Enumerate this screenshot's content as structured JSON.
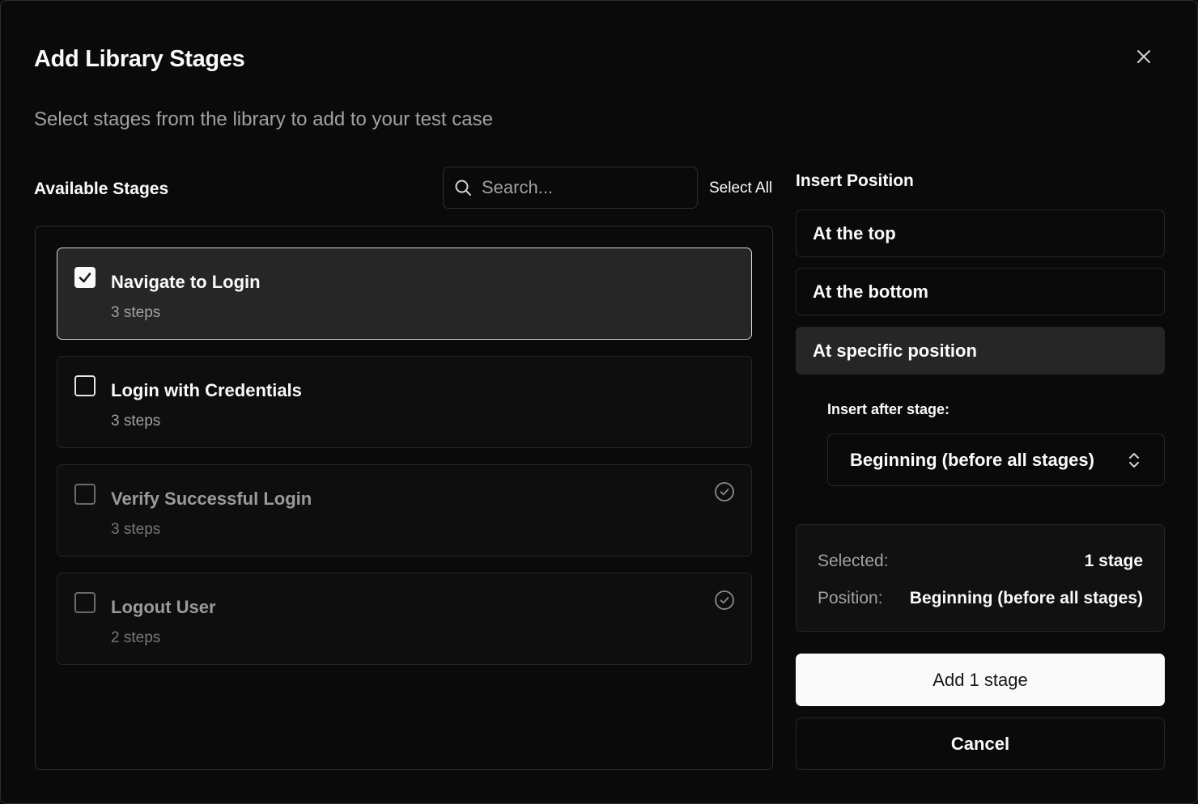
{
  "dialog": {
    "title": "Add Library Stages",
    "subtitle": "Select stages from the library to add to your test case",
    "close_icon": "close-icon"
  },
  "available": {
    "label": "Available Stages",
    "search_placeholder": "Search...",
    "select_all": "Select All",
    "stages": [
      {
        "name": "Navigate to Login",
        "steps": "3 steps",
        "checked": true,
        "already_added": false
      },
      {
        "name": "Login with Credentials",
        "steps": "3 steps",
        "checked": false,
        "already_added": false
      },
      {
        "name": "Verify Successful Login",
        "steps": "3 steps",
        "checked": false,
        "already_added": true
      },
      {
        "name": "Logout User",
        "steps": "2 steps",
        "checked": false,
        "already_added": true
      }
    ]
  },
  "insert_position": {
    "label": "Insert Position",
    "options": [
      "At the top",
      "At the bottom",
      "At specific position"
    ],
    "active_option": "At specific position",
    "after_label": "Insert after stage:",
    "after_value": "Beginning (before all stages)"
  },
  "summary": {
    "selected_label": "Selected:",
    "selected_value": "1 stage",
    "position_label": "Position:",
    "position_value": "Beginning (before all stages)"
  },
  "actions": {
    "primary": "Add 1 stage",
    "cancel": "Cancel"
  },
  "colors": {
    "background": "#0a0a0a",
    "border": "#262626",
    "selected_bg": "#262626",
    "primary_button": "#fafafa"
  }
}
